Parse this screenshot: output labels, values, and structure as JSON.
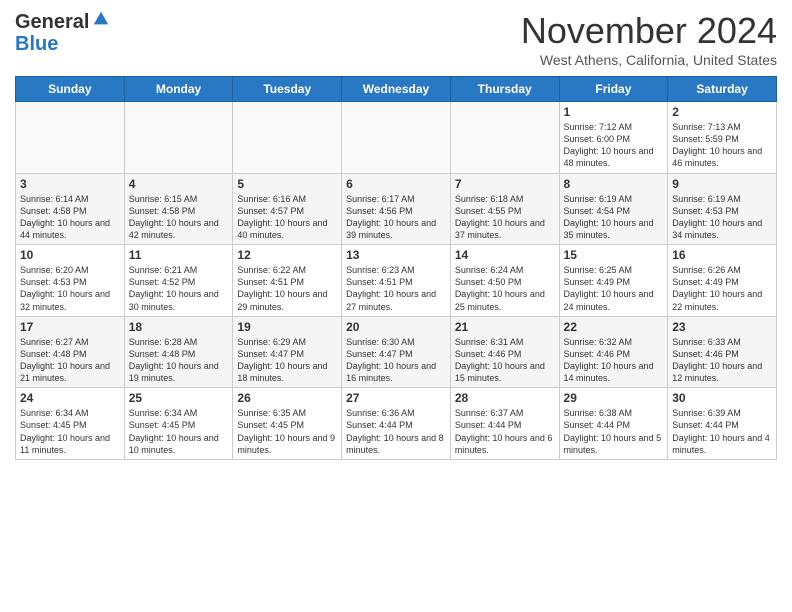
{
  "header": {
    "logo": {
      "general": "General",
      "blue": "Blue"
    },
    "title": "November 2024",
    "location": "West Athens, California, United States"
  },
  "weekdays": [
    "Sunday",
    "Monday",
    "Tuesday",
    "Wednesday",
    "Thursday",
    "Friday",
    "Saturday"
  ],
  "weeks": [
    [
      {
        "day": "",
        "info": ""
      },
      {
        "day": "",
        "info": ""
      },
      {
        "day": "",
        "info": ""
      },
      {
        "day": "",
        "info": ""
      },
      {
        "day": "",
        "info": ""
      },
      {
        "day": "1",
        "info": "Sunrise: 7:12 AM\nSunset: 6:00 PM\nDaylight: 10 hours and 48 minutes."
      },
      {
        "day": "2",
        "info": "Sunrise: 7:13 AM\nSunset: 5:59 PM\nDaylight: 10 hours and 46 minutes."
      }
    ],
    [
      {
        "day": "3",
        "info": "Sunrise: 6:14 AM\nSunset: 4:58 PM\nDaylight: 10 hours and 44 minutes."
      },
      {
        "day": "4",
        "info": "Sunrise: 6:15 AM\nSunset: 4:58 PM\nDaylight: 10 hours and 42 minutes."
      },
      {
        "day": "5",
        "info": "Sunrise: 6:16 AM\nSunset: 4:57 PM\nDaylight: 10 hours and 40 minutes."
      },
      {
        "day": "6",
        "info": "Sunrise: 6:17 AM\nSunset: 4:56 PM\nDaylight: 10 hours and 39 minutes."
      },
      {
        "day": "7",
        "info": "Sunrise: 6:18 AM\nSunset: 4:55 PM\nDaylight: 10 hours and 37 minutes."
      },
      {
        "day": "8",
        "info": "Sunrise: 6:19 AM\nSunset: 4:54 PM\nDaylight: 10 hours and 35 minutes."
      },
      {
        "day": "9",
        "info": "Sunrise: 6:19 AM\nSunset: 4:53 PM\nDaylight: 10 hours and 34 minutes."
      }
    ],
    [
      {
        "day": "10",
        "info": "Sunrise: 6:20 AM\nSunset: 4:53 PM\nDaylight: 10 hours and 32 minutes."
      },
      {
        "day": "11",
        "info": "Sunrise: 6:21 AM\nSunset: 4:52 PM\nDaylight: 10 hours and 30 minutes."
      },
      {
        "day": "12",
        "info": "Sunrise: 6:22 AM\nSunset: 4:51 PM\nDaylight: 10 hours and 29 minutes."
      },
      {
        "day": "13",
        "info": "Sunrise: 6:23 AM\nSunset: 4:51 PM\nDaylight: 10 hours and 27 minutes."
      },
      {
        "day": "14",
        "info": "Sunrise: 6:24 AM\nSunset: 4:50 PM\nDaylight: 10 hours and 25 minutes."
      },
      {
        "day": "15",
        "info": "Sunrise: 6:25 AM\nSunset: 4:49 PM\nDaylight: 10 hours and 24 minutes."
      },
      {
        "day": "16",
        "info": "Sunrise: 6:26 AM\nSunset: 4:49 PM\nDaylight: 10 hours and 22 minutes."
      }
    ],
    [
      {
        "day": "17",
        "info": "Sunrise: 6:27 AM\nSunset: 4:48 PM\nDaylight: 10 hours and 21 minutes."
      },
      {
        "day": "18",
        "info": "Sunrise: 6:28 AM\nSunset: 4:48 PM\nDaylight: 10 hours and 19 minutes."
      },
      {
        "day": "19",
        "info": "Sunrise: 6:29 AM\nSunset: 4:47 PM\nDaylight: 10 hours and 18 minutes."
      },
      {
        "day": "20",
        "info": "Sunrise: 6:30 AM\nSunset: 4:47 PM\nDaylight: 10 hours and 16 minutes."
      },
      {
        "day": "21",
        "info": "Sunrise: 6:31 AM\nSunset: 4:46 PM\nDaylight: 10 hours and 15 minutes."
      },
      {
        "day": "22",
        "info": "Sunrise: 6:32 AM\nSunset: 4:46 PM\nDaylight: 10 hours and 14 minutes."
      },
      {
        "day": "23",
        "info": "Sunrise: 6:33 AM\nSunset: 4:46 PM\nDaylight: 10 hours and 12 minutes."
      }
    ],
    [
      {
        "day": "24",
        "info": "Sunrise: 6:34 AM\nSunset: 4:45 PM\nDaylight: 10 hours and 11 minutes."
      },
      {
        "day": "25",
        "info": "Sunrise: 6:34 AM\nSunset: 4:45 PM\nDaylight: 10 hours and 10 minutes."
      },
      {
        "day": "26",
        "info": "Sunrise: 6:35 AM\nSunset: 4:45 PM\nDaylight: 10 hours and 9 minutes."
      },
      {
        "day": "27",
        "info": "Sunrise: 6:36 AM\nSunset: 4:44 PM\nDaylight: 10 hours and 8 minutes."
      },
      {
        "day": "28",
        "info": "Sunrise: 6:37 AM\nSunset: 4:44 PM\nDaylight: 10 hours and 6 minutes."
      },
      {
        "day": "29",
        "info": "Sunrise: 6:38 AM\nSunset: 4:44 PM\nDaylight: 10 hours and 5 minutes."
      },
      {
        "day": "30",
        "info": "Sunrise: 6:39 AM\nSunset: 4:44 PM\nDaylight: 10 hours and 4 minutes."
      }
    ]
  ]
}
